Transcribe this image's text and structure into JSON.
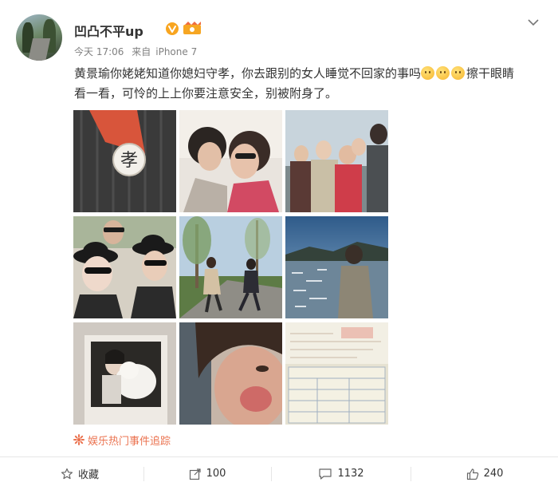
{
  "post": {
    "username": "凹凸不平up",
    "time": "今天 17:06",
    "source_prefix": "来自",
    "source": "iPhone 7",
    "text_part1": "黄景瑜你姥姥知道你媳妇守孝，你去跟别的女人睡觉不回家的事吗",
    "text_part2": "擦干眼睛看一看，可怜的上上你要注意安全，别被附身了。",
    "emoji_count": 3,
    "topic": "娱乐热门事件追踪"
  },
  "photos": [
    {
      "name": "photo-mourning-badge",
      "badge_text": "孝"
    },
    {
      "name": "photo-kiss-selfie"
    },
    {
      "name": "photo-family-group"
    },
    {
      "name": "photo-couple-hats"
    },
    {
      "name": "photo-park-playing"
    },
    {
      "name": "photo-lake-view"
    },
    {
      "name": "photo-girl-with-dog"
    },
    {
      "name": "photo-face-closeup"
    },
    {
      "name": "photo-hospital-document"
    }
  ],
  "actions": {
    "favorite_label": "收藏",
    "repost_count": "100",
    "comment_count": "1132",
    "like_count": "240"
  },
  "colors": {
    "topic": "#eb7350",
    "verified_badge": "#f8a520",
    "divider": "#e6e6e6"
  }
}
